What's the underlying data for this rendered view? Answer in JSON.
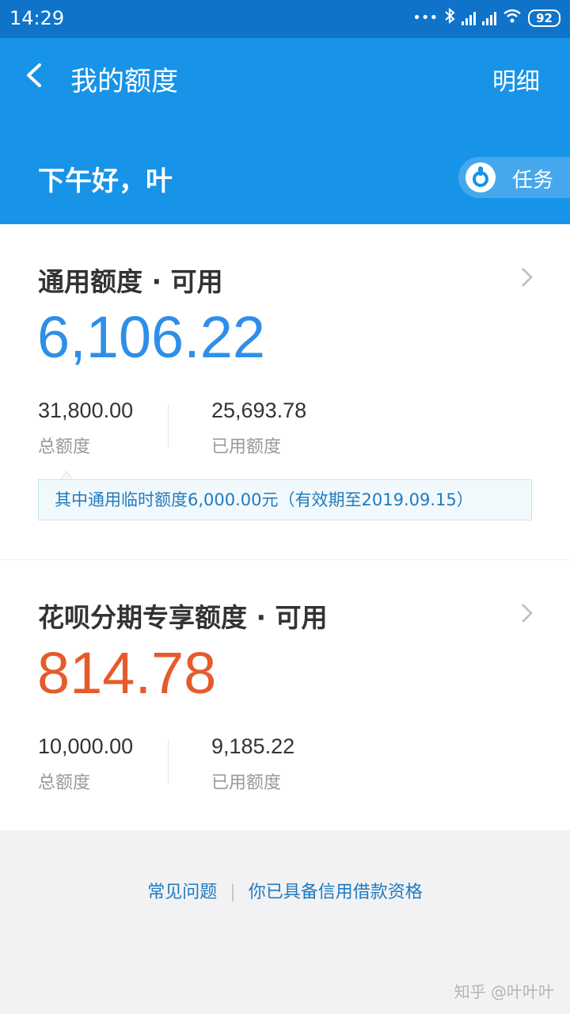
{
  "status_bar": {
    "time": "14:29",
    "battery": "92",
    "icons": [
      "more-dots-icon",
      "bluetooth-icon",
      "signal-icon",
      "signal-icon",
      "wifi-icon",
      "battery-icon"
    ]
  },
  "header": {
    "title": "我的额度",
    "detail_label": "明细",
    "greeting": "下午好，叶",
    "task_label": "任务",
    "bg_color": "#1793e8"
  },
  "general_quota": {
    "title": "通用额度 · 可用",
    "available": "6,106.22",
    "total_value": "31,800.00",
    "total_label": "总额度",
    "used_value": "25,693.78",
    "used_label": "已用额度",
    "note": "其中通用临时额度6,000.00元（有效期至2019.09.15）",
    "accent_color": "#2e8fe8"
  },
  "installment_quota": {
    "title": "花呗分期专享额度 · 可用",
    "available": "814.78",
    "total_value": "10,000.00",
    "total_label": "总额度",
    "used_value": "9,185.22",
    "used_label": "已用额度",
    "accent_color": "#e55b2c"
  },
  "footer": {
    "faq_label": "常见问题",
    "separator": "|",
    "credit_label": "你已具备信用借款资格"
  },
  "watermark": "知乎 @叶叶叶"
}
